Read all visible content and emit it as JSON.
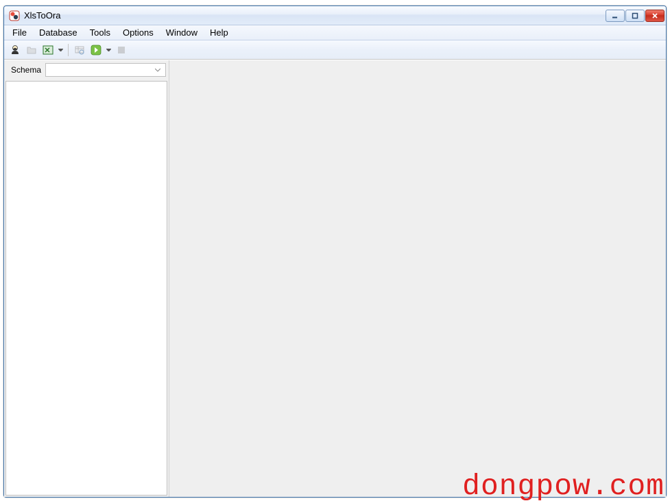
{
  "window": {
    "title": "XlsToOra"
  },
  "menu": {
    "items": [
      "File",
      "Database",
      "Tools",
      "Options",
      "Window",
      "Help"
    ]
  },
  "sidebar": {
    "schema_label": "Schema",
    "schema_value": ""
  },
  "watermark": "dongpow.com"
}
